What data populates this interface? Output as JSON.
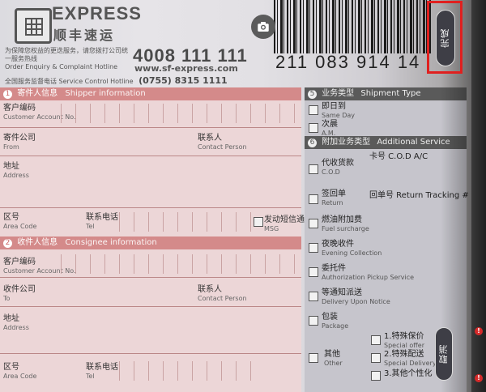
{
  "brand": {
    "name_en": "EXPRESS",
    "name_cn": "顺丰速运"
  },
  "header": {
    "notice_cn": "为保障您权益的更迭服务，请您拨打公司统一服务热线",
    "hotline_label": "Order Enquiry & Complaint Hotline",
    "hotline": "4008 111 111",
    "website": "www.sf-express.com",
    "service_label_cn": "全国服务监督电话",
    "service_label_en": "Service Control Hotline",
    "service_number": "(0755) 8315 1111"
  },
  "tracking_number": "211 083 914 14",
  "shipper": {
    "num": "1",
    "title_cn": "寄件人信息",
    "title_en": "Shipper information",
    "fields": [
      {
        "cn": "客户编码",
        "en": "Customer Account No."
      },
      {
        "cn": "寄件公司",
        "en": "From"
      },
      {
        "cn": "联系人",
        "en": "Contact Person"
      },
      {
        "cn": "地址",
        "en": "Address"
      },
      {
        "cn": "区号",
        "en": "Area Code"
      },
      {
        "cn": "联系电话",
        "en": "Tel"
      },
      {
        "cn": "发动短信通知",
        "en": "MSG"
      }
    ]
  },
  "consignee": {
    "num": "2",
    "title_cn": "收件人信息",
    "title_en": "Consignee information",
    "fields": [
      {
        "cn": "客户编码",
        "en": "Customer Account No."
      },
      {
        "cn": "收件公司",
        "en": "To"
      },
      {
        "cn": "联系人",
        "en": "Contact Person"
      },
      {
        "cn": "地址",
        "en": "Address"
      },
      {
        "cn": "区号",
        "en": "Area Code"
      },
      {
        "cn": "联系电话",
        "en": "Tel"
      }
    ]
  },
  "shipment_type": {
    "num": "5",
    "title_cn": "业务类型",
    "title_en": "Shipment Type",
    "options": [
      {
        "cn": "即日到",
        "en": "Same Day"
      },
      {
        "cn": "次晨",
        "en": "A.M."
      }
    ]
  },
  "additional_service": {
    "num": "6",
    "title_cn": "附加业务类型",
    "title_en": "Additional Service",
    "options": [
      {
        "cn": "代收货款",
        "en": "C.O.D",
        "extra": "卡号 C.O.D A/C"
      },
      {
        "cn": "签回单",
        "en": "Return",
        "extra": "回单号 Return Tracking #"
      },
      {
        "cn": "燃油附加费",
        "en": "Fuel surcharge"
      },
      {
        "cn": "夜晚收件",
        "en": "Evening Collection"
      },
      {
        "cn": "委托件",
        "en": "Authorization Pickup Service"
      },
      {
        "cn": "等通知派送",
        "en": "Delivery Upon Notice"
      },
      {
        "cn": "包装",
        "en": "Package"
      },
      {
        "cn": "其他",
        "en": "Other"
      }
    ],
    "other_sub": [
      {
        "cn": "1.特殊保价",
        "en": "Special offer"
      },
      {
        "cn": "2.特殊配送",
        "en": "Special Delivery"
      },
      {
        "cn": "3.其他个性化",
        "en": ""
      }
    ]
  },
  "overlay": {
    "done_label": "完成",
    "cancel_label": "取消"
  },
  "colors": {
    "accent_red": "#e0201f",
    "section_pink": "#d48a8a",
    "button_dark": "#3e3e46"
  }
}
